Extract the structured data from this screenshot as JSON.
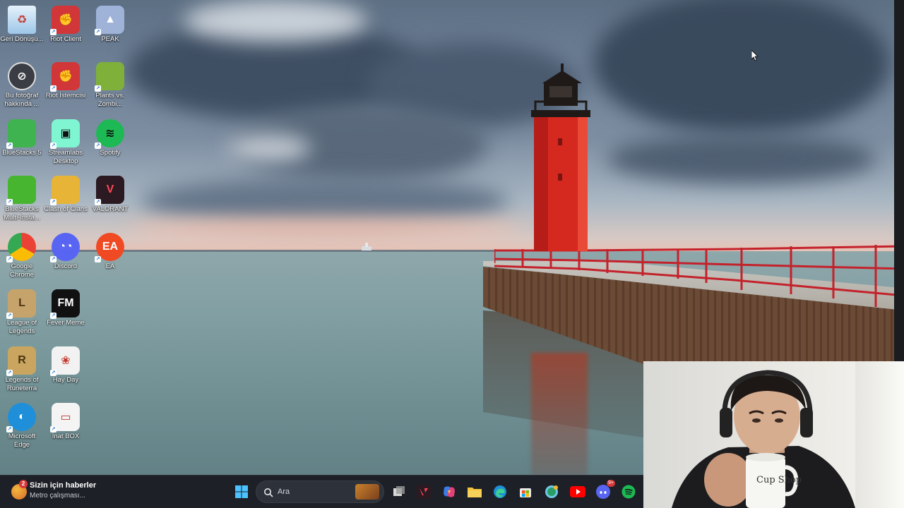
{
  "desktop": {
    "icons": [
      {
        "label": "Geri Dönüşü...",
        "icon": "recycle-bin-icon",
        "color": "#6aa6d8"
      },
      {
        "label": "Riot Client",
        "icon": "riot-client-icon",
        "color": "#d13639"
      },
      {
        "label": "PEAK",
        "icon": "peak-icon",
        "color": "#9fb3d9"
      },
      {
        "label": "Bu fotoğraf hakkında ...",
        "icon": "photo-info-icon",
        "color": "#3a3d44"
      },
      {
        "label": "Riot İstemcisi",
        "icon": "riot-client-icon",
        "color": "#d13639"
      },
      {
        "label": "Plants vs. Zombi...",
        "icon": "plants-vs-zombies-icon",
        "color": "#7fb13a"
      },
      {
        "label": "BlueStacks 5",
        "icon": "bluestacks-icon",
        "color": "#3fb34f"
      },
      {
        "label": "Streamlabs Desktop",
        "icon": "streamlabs-icon",
        "color": "#80f5d2"
      },
      {
        "label": "Spotify",
        "icon": "spotify-icon",
        "color": "#1db954"
      },
      {
        "label": "BlueStacks Multi-İnsta...",
        "icon": "bluestacks-multi-icon",
        "color": "#47b52f"
      },
      {
        "label": "Clash of Clans",
        "icon": "clash-of-clans-icon",
        "color": "#e7b437"
      },
      {
        "label": "VALORANT",
        "icon": "valorant-icon",
        "color": "#2b1a22"
      },
      {
        "label": "Google Chrome",
        "icon": "chrome-icon",
        "color": "#e84335"
      },
      {
        "label": "Discord",
        "icon": "discord-icon",
        "color": "#5865f2"
      },
      {
        "label": "EA",
        "icon": "ea-icon",
        "color": "#ef4a23"
      },
      {
        "label": "League of Legends",
        "icon": "league-of-legends-icon",
        "color": "#c6a36a"
      },
      {
        "label": "Fever Meme",
        "icon": "fever-meme-icon",
        "color": "#111111"
      },
      {
        "label": "Legends of Runeterra",
        "icon": "legends-of-runeterra-icon",
        "color": "#c9a560"
      },
      {
        "label": "Hay Day",
        "icon": "hay-day-icon",
        "color": "#f2f2f2"
      },
      {
        "label": "Microsoft Edge",
        "icon": "edge-icon",
        "color": "#1e8fd8"
      },
      {
        "label": "İnat BOX",
        "icon": "inat-box-icon",
        "color": "#f4f4f4"
      }
    ]
  },
  "taskbar": {
    "news_title": "Sizin için haberler",
    "news_subtitle": "Metro çalışması...",
    "news_badge": "2",
    "search_placeholder": "Ara",
    "pinned": [
      "start-icon",
      "widgets-search-art-icon",
      "task-view-icon",
      "valorant-icon",
      "copilot-icon",
      "file-explorer-icon",
      "edge-icon",
      "microsoft-store-icon",
      "whatsapp-icon",
      "youtube-icon",
      "discord-icon",
      "spotify-icon"
    ],
    "discord_badge": "9+"
  },
  "webcam": {
    "mug_text": "Cup Shop"
  }
}
